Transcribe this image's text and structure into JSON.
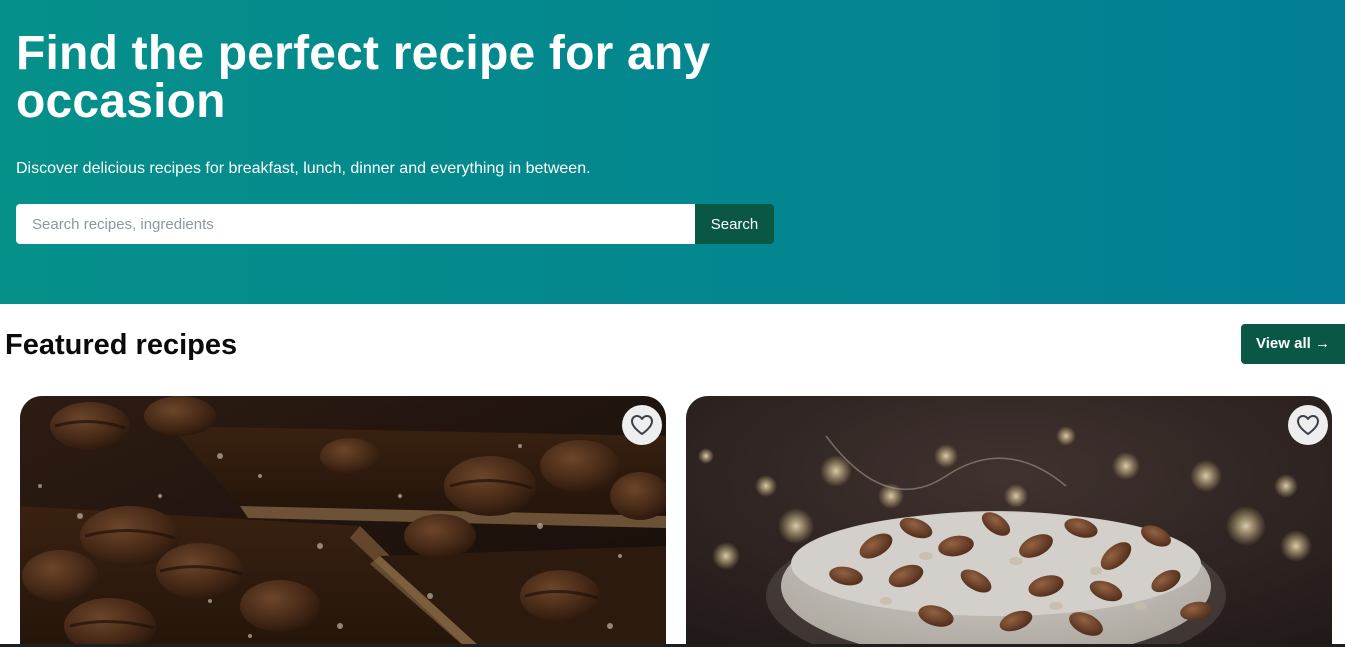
{
  "hero": {
    "title": "Find the perfect recipe for any occasion",
    "subtitle": "Discover delicious recipes for breakfast, lunch, dinner and everything in between.",
    "search": {
      "placeholder": "Search recipes, ingredients",
      "value": "",
      "button_label": "Search"
    },
    "gradient_colors": [
      "#05908a",
      "#037e94"
    ]
  },
  "featured": {
    "title": "Featured recipes",
    "view_all_label": "View all →",
    "cards": [
      {
        "image": "pecan-pie-photo",
        "favorite_icon": "heart-outline-icon"
      },
      {
        "image": "almond-dessert-cup-photo",
        "favorite_icon": "heart-outline-icon"
      }
    ]
  },
  "colors": {
    "accent_dark_green": "#0a5746",
    "white": "#ffffff"
  }
}
